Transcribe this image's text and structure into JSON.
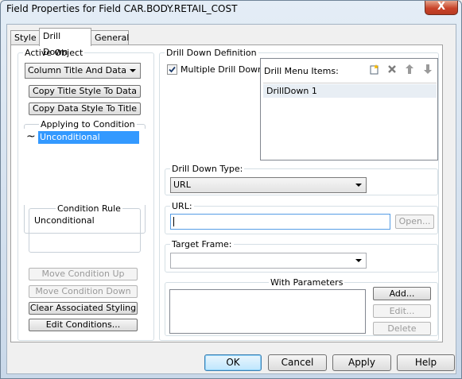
{
  "window": {
    "title": "Field Properties for Field CAR.BODY.RETAIL_COST",
    "close_glyph": "X"
  },
  "tabs": [
    {
      "label": "Style"
    },
    {
      "label": "Drill Down"
    },
    {
      "label": "General"
    }
  ],
  "active_object": {
    "legend": "Active Object",
    "combo_value": "Column Title And Data",
    "copy_title_button": "Copy Title Style To Data",
    "copy_data_button": "Copy Data Style To Title",
    "applying_legend": "Applying to Condition",
    "conditions": [
      {
        "symbol": "~",
        "label": "Unconditional"
      }
    ],
    "condition_rule_legend": "Condition Rule",
    "condition_rule_text": "Unconditional",
    "move_up_button": "Move Condition Up",
    "move_down_button": "Move Condition Down",
    "clear_styling_button": "Clear Associated Styling",
    "edit_conditions_button": "Edit Conditions..."
  },
  "drill_down": {
    "legend": "Drill Down Definition",
    "multiple_checkbox_label": "Multiple Drill Downs",
    "multiple_checked": true,
    "menu_items_label": "Drill Menu Items:",
    "menu_items": [
      "DrillDown 1"
    ],
    "type_legend": "Drill Down Type:",
    "type_value": "URL",
    "url_legend": "URL:",
    "url_value": "",
    "open_button": "Open...",
    "target_legend": "Target Frame:",
    "target_value": "",
    "params_legend": "With Parameters",
    "add_button": "Add...",
    "edit_button": "Edit...",
    "delete_button": "Delete"
  },
  "footer": {
    "ok": "OK",
    "cancel": "Cancel",
    "apply": "Apply",
    "help": "Help"
  },
  "icons": {
    "new_item": "new-item-icon",
    "delete_item": "delete-x-icon",
    "move_up": "arrow-up-icon",
    "move_down": "arrow-down-icon"
  }
}
